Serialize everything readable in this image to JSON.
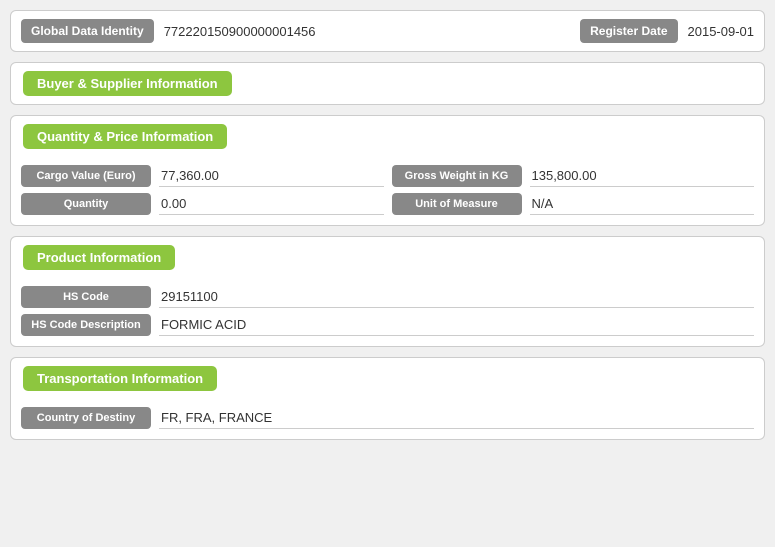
{
  "header": {
    "gdi_label": "Global Data Identity",
    "gdi_value": "772220150900000001456",
    "register_label": "Register Date",
    "register_value": "2015-09-01"
  },
  "sections": {
    "buyer_supplier": {
      "title": "Buyer & Supplier Information",
      "fields": []
    },
    "quantity_price": {
      "title": "Quantity & Price Information",
      "rows": [
        {
          "left_label": "Cargo Value (Euro)",
          "left_value": "77,360.00",
          "right_label": "Gross Weight in KG",
          "right_value": "135,800.00"
        },
        {
          "left_label": "Quantity",
          "left_value": "0.00",
          "right_label": "Unit of Measure",
          "right_value": "N/A"
        }
      ]
    },
    "product": {
      "title": "Product Information",
      "rows": [
        {
          "label": "HS Code",
          "value": "29151100"
        },
        {
          "label": "HS Code Description",
          "value": "FORMIC ACID"
        }
      ]
    },
    "transportation": {
      "title": "Transportation Information",
      "rows": [
        {
          "label": "Country of Destiny",
          "value": "FR, FRA, FRANCE"
        }
      ]
    }
  }
}
